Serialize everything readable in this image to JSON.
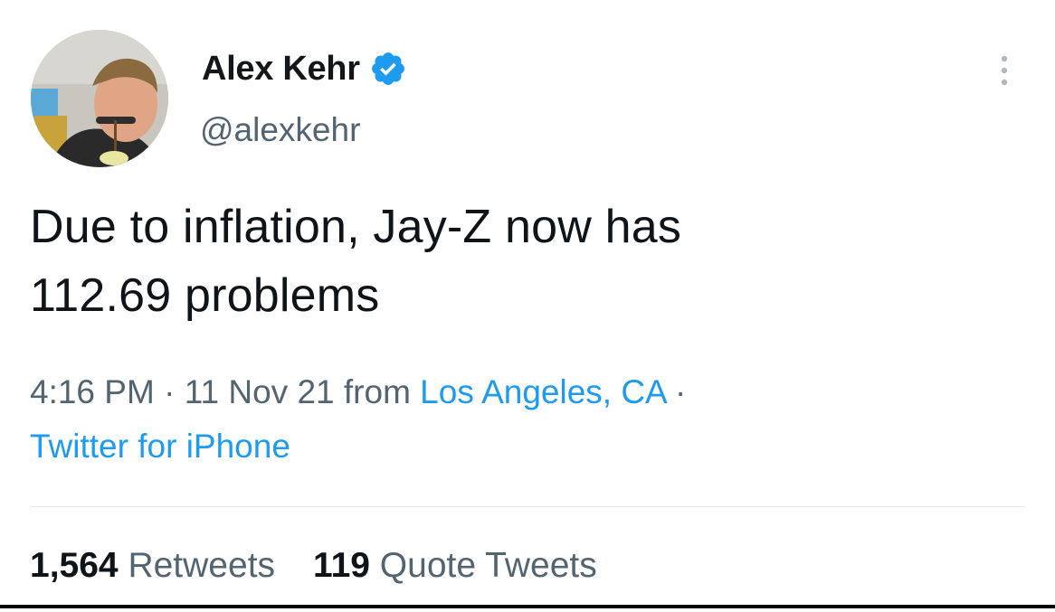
{
  "author": {
    "display_name": "Alex Kehr",
    "handle": "@alexkehr",
    "verified_icon": "verified-badge-icon"
  },
  "tweet": {
    "text_line1": "Due to inflation, Jay-Z now has",
    "text_line2": "112.69 problems"
  },
  "meta": {
    "time": "4:16 PM",
    "separator": " · ",
    "date": "11 Nov 21",
    "from_label": " from ",
    "location": "Los Angeles, CA",
    "trailing_separator": " ·",
    "source": "Twitter for iPhone"
  },
  "stats": {
    "retweets_count": "1,564",
    "retweets_label": "Retweets",
    "quotes_count": "119",
    "quotes_label": "Quote Tweets"
  },
  "colors": {
    "accent": "#1d9bf0",
    "secondary_text": "#536471",
    "primary_text": "#0f1419"
  }
}
